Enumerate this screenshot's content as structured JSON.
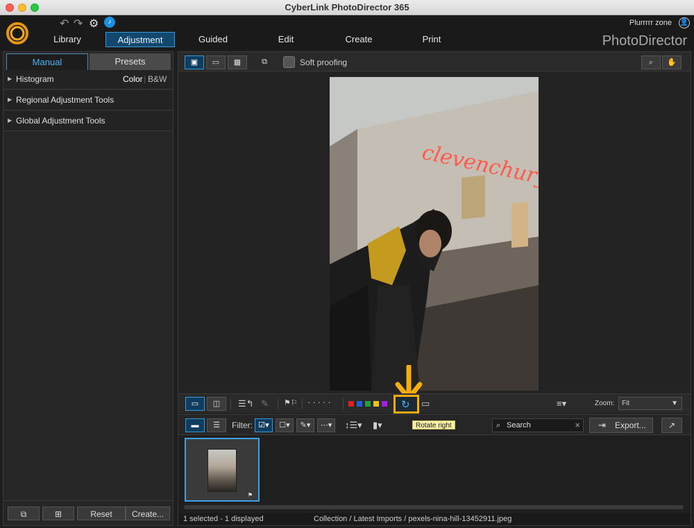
{
  "window": {
    "title": "CyberLink PhotoDirector 365"
  },
  "header": {
    "tabs": [
      "Library",
      "Adjustment",
      "Guided",
      "Edit",
      "Create",
      "Print"
    ],
    "active_tab": "Adjustment",
    "user_name": "Plurrrrr zone",
    "brand": "PhotoDirector"
  },
  "left_panel": {
    "tabs": [
      "Manual",
      "Presets"
    ],
    "active_tab": "Manual",
    "sections": [
      {
        "label": "Histogram",
        "color_label": "Color",
        "bw_label": "B&W"
      },
      {
        "label": "Regional Adjustment Tools"
      },
      {
        "label": "Global Adjustment Tools"
      }
    ],
    "buttons": {
      "reset": "Reset",
      "create": "Create..."
    }
  },
  "top_toolbar": {
    "soft_proofing_label": "Soft proofing",
    "soft_proofing_checked": false
  },
  "photo": {
    "neon_text": "clevenchury"
  },
  "bottom_toolbar": {
    "color_labels": [
      "#e02020",
      "#2060e0",
      "#20a040",
      "#f0c020",
      "#a020e0"
    ],
    "zoom_label": "Zoom:",
    "zoom_value": "Fit",
    "tooltip": "Rotate right"
  },
  "filter_toolbar": {
    "filter_label": "Filter:",
    "search_placeholder": "Search",
    "export_label": "Export..."
  },
  "status": {
    "selection": "1 selected - 1 displayed",
    "path": "Collection / Latest Imports / pexels-nina-hill-13452911.jpeg"
  }
}
